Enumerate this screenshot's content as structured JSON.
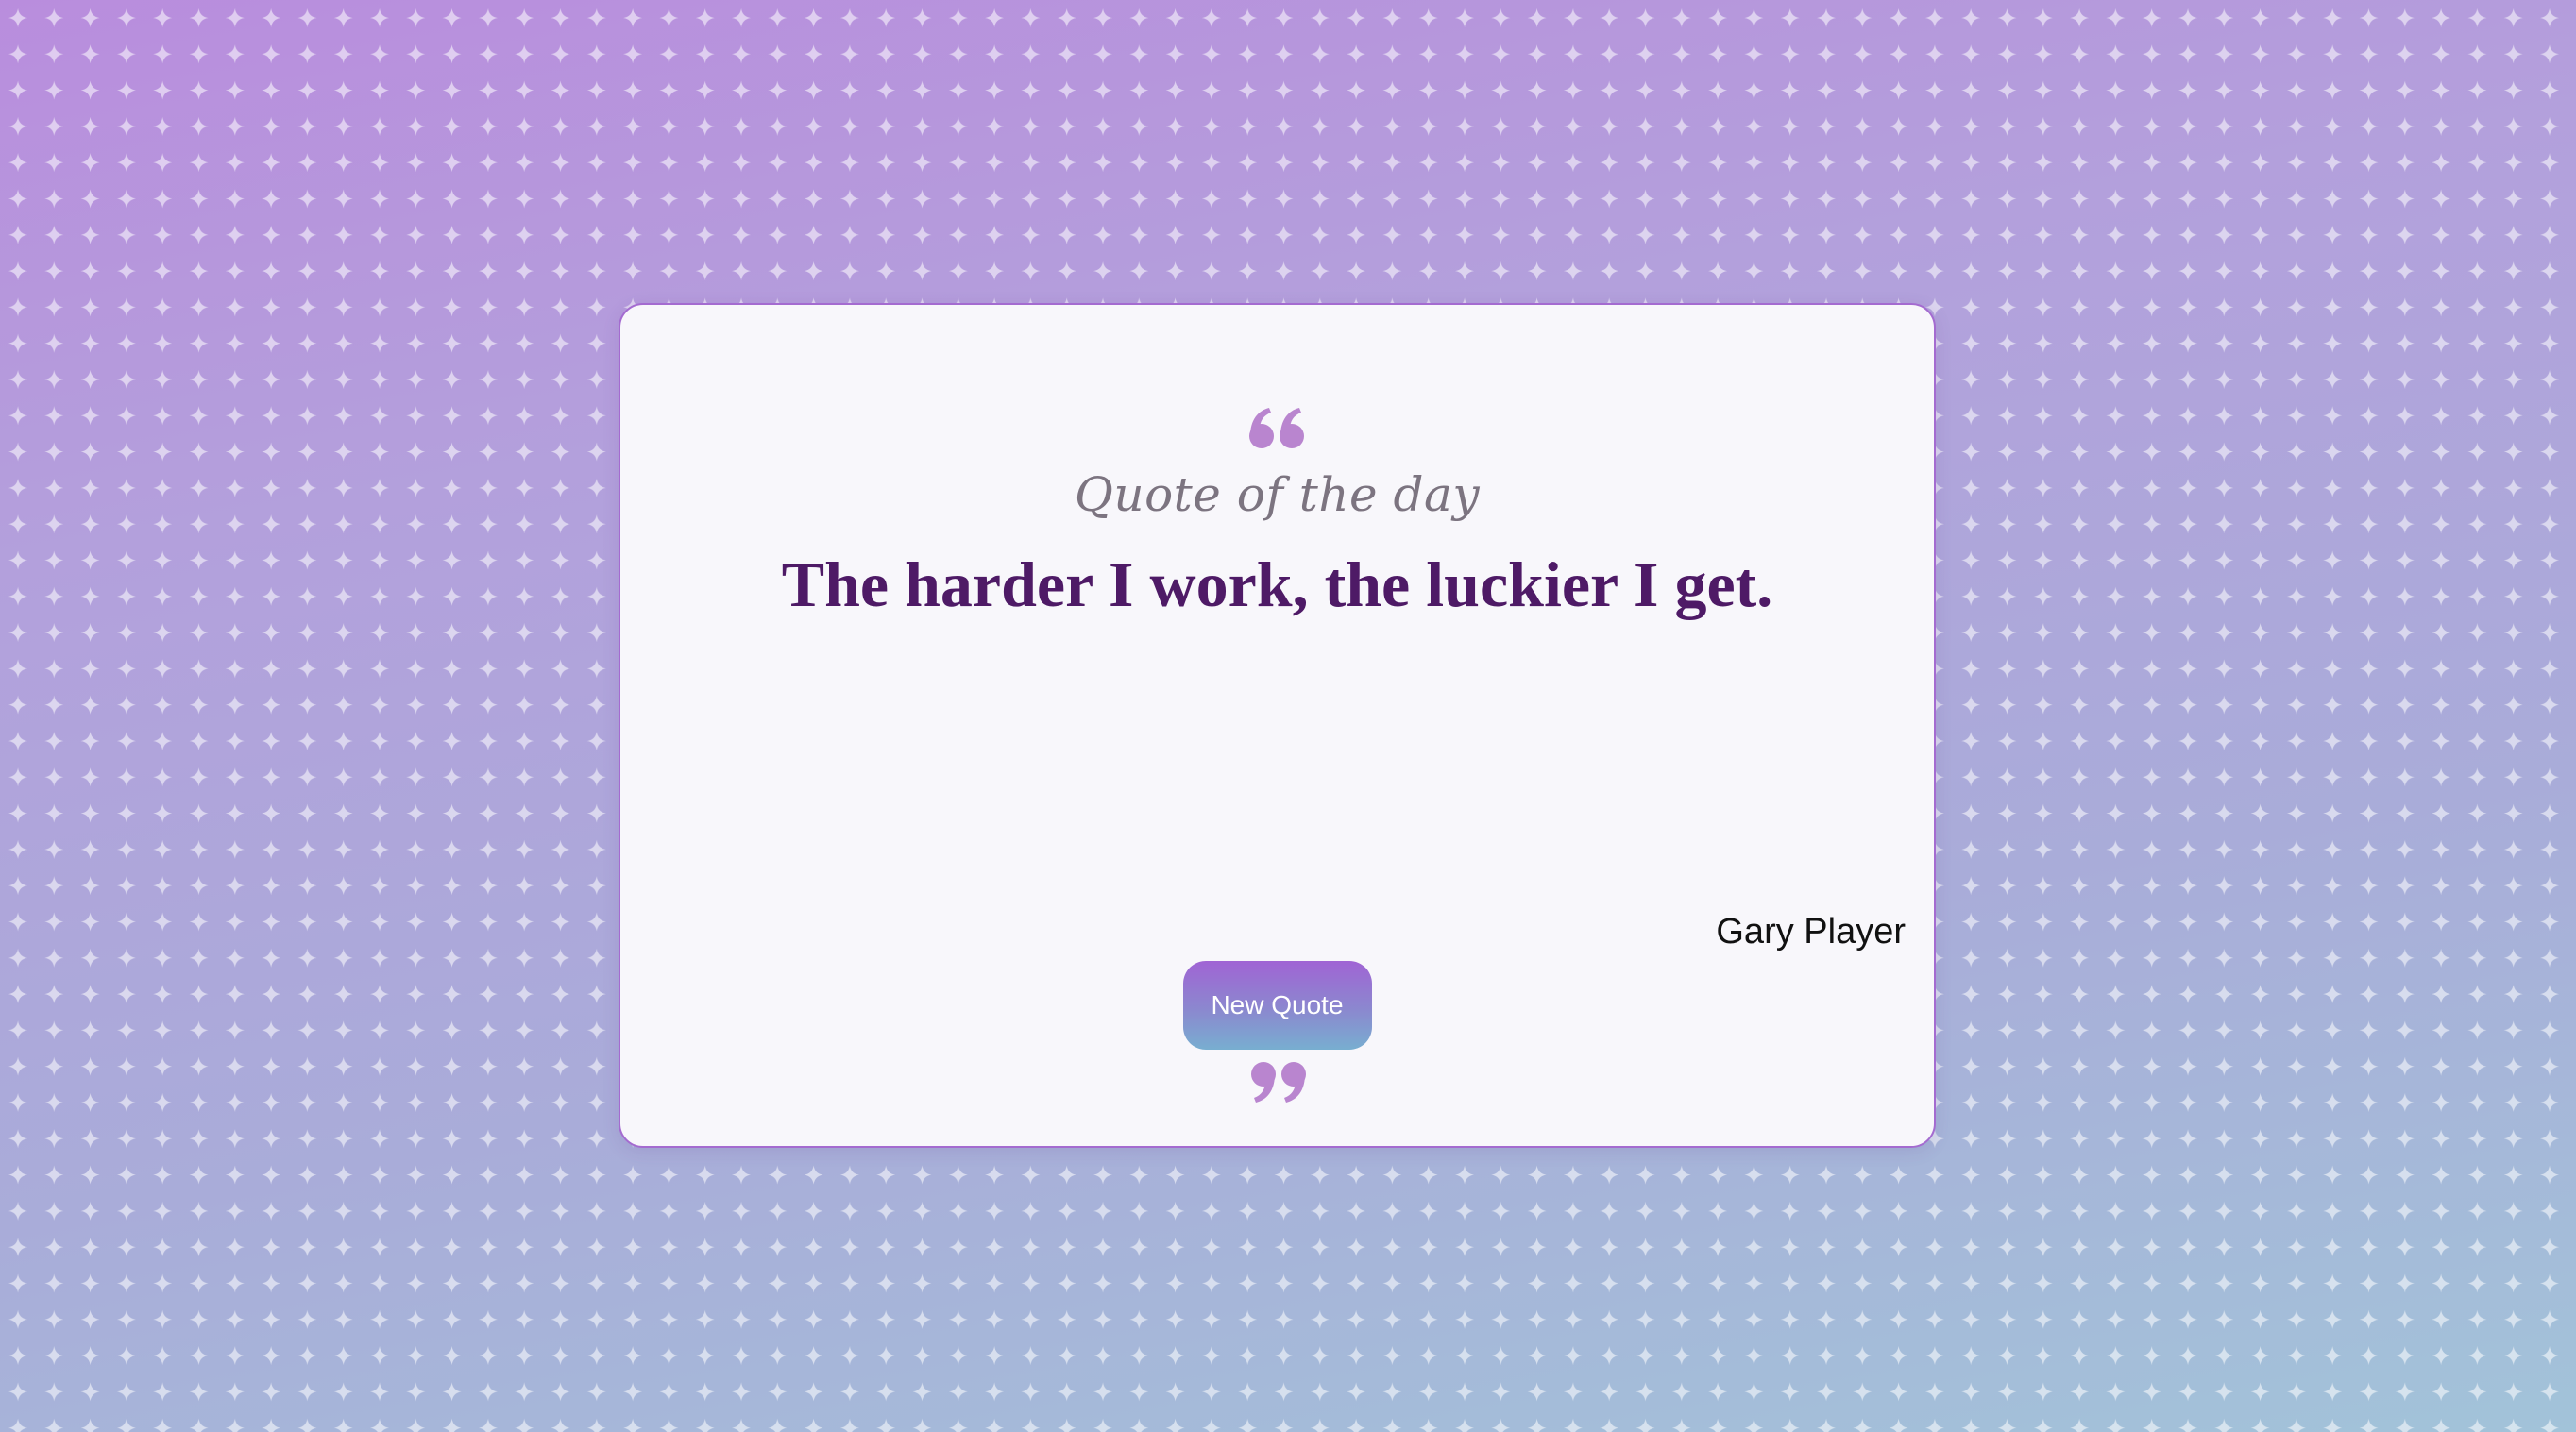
{
  "colors": {
    "background_top": "#b98ddd",
    "background_bottom": "#a2c3d9",
    "card_background": "#f8f7fb",
    "card_border": "#a46bd0",
    "quote_mark": "#b985cf",
    "heading_text": "#7c7480",
    "quote_text": "#4e1a66",
    "author_text": "#111111",
    "button_gradient_top": "#a064d4",
    "button_gradient_bottom": "#78aed0",
    "button_text": "#ffffff"
  },
  "card": {
    "open_quote_icon": "left-double-quote-icon",
    "heading": "Quote of the day",
    "quote": "The harder I work, the luckier I get.",
    "author": "Gary Player",
    "button_label": "New Quote",
    "close_quote_icon": "right-double-quote-icon"
  },
  "background": {
    "pattern_icon": "sparkle-star-icon"
  }
}
